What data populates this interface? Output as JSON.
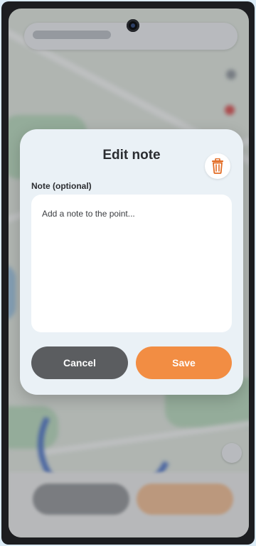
{
  "dialog": {
    "title": "Edit note",
    "note_label": "Note (optional)",
    "note_placeholder": "Add a note to the point...",
    "note_value": "",
    "cancel_label": "Cancel",
    "save_label": "Save",
    "delete_icon": "trash-icon"
  },
  "colors": {
    "accent": "#f28d43",
    "cancel": "#5b5d60",
    "delete_icon": "#e26b23",
    "dialog_bg": "#eaf1f6"
  }
}
